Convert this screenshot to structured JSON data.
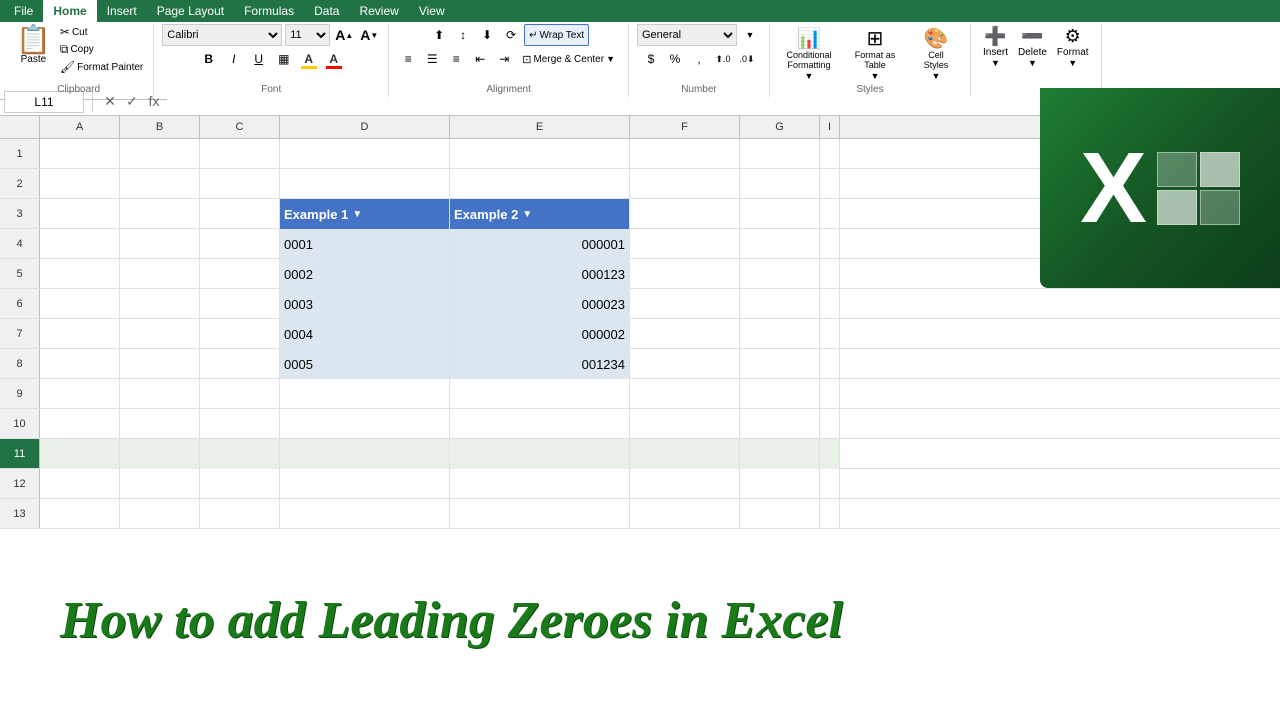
{
  "ribbon": {
    "tabs": [
      "File",
      "Home",
      "Insert",
      "Page Layout",
      "Formulas",
      "Data",
      "Review",
      "View"
    ],
    "active_tab": "Home",
    "clipboard": {
      "label": "Clipboard",
      "paste": "Paste",
      "copy": "Copy",
      "cut": "Cut",
      "format_painter": "Format Painter"
    },
    "font": {
      "label": "Font",
      "name": "Calibri",
      "size": "11",
      "bold": "B",
      "italic": "I",
      "underline": "U",
      "increase_size": "A",
      "decrease_size": "A",
      "fill_color": "A",
      "font_color": "A",
      "borders": "▦"
    },
    "alignment": {
      "label": "Alignment",
      "wrap_text": "Wrap Text",
      "merge_center": "Merge & Center"
    },
    "number": {
      "label": "Number",
      "format": "General",
      "dollar": "$",
      "percent": "%",
      "comma": ",",
      "inc_decimal": ".0",
      "dec_decimal": ".0"
    },
    "styles": {
      "label": "Styles",
      "conditional": "Conditional\nFormatting",
      "format_table": "Format as\nTable",
      "cell_styles": "Cell\nStyles"
    },
    "cells": {
      "label": "",
      "insert": "Insert",
      "delete": "Delete",
      "format": "Format"
    }
  },
  "formula_bar": {
    "name_box": "L11",
    "cancel": "✕",
    "confirm": "✓",
    "function": "fx"
  },
  "columns": [
    "A",
    "B",
    "C",
    "D",
    "E",
    "F",
    "G",
    "I"
  ],
  "rows": [
    {
      "num": 1,
      "cells": [
        "",
        "",
        "",
        "",
        "",
        "",
        "",
        ""
      ]
    },
    {
      "num": 2,
      "cells": [
        "",
        "",
        "",
        "",
        "",
        "",
        "",
        ""
      ]
    },
    {
      "num": 3,
      "cells": [
        "",
        "",
        "",
        "Example 1",
        "Example 2",
        "",
        "",
        ""
      ]
    },
    {
      "num": 4,
      "cells": [
        "",
        "",
        "",
        "0001",
        "000001",
        "",
        "",
        ""
      ]
    },
    {
      "num": 5,
      "cells": [
        "",
        "",
        "",
        "0002",
        "000123",
        "",
        "",
        ""
      ]
    },
    {
      "num": 6,
      "cells": [
        "",
        "",
        "",
        "0003",
        "000023",
        "",
        "",
        ""
      ]
    },
    {
      "num": 7,
      "cells": [
        "",
        "",
        "",
        "0004",
        "000002",
        "",
        "",
        ""
      ]
    },
    {
      "num": 8,
      "cells": [
        "",
        "",
        "",
        "0005",
        "001234",
        "",
        "",
        ""
      ]
    },
    {
      "num": 9,
      "cells": [
        "",
        "",
        "",
        "",
        "",
        "",
        "",
        ""
      ]
    },
    {
      "num": 10,
      "cells": [
        "",
        "",
        "",
        "",
        "",
        "",
        "",
        ""
      ]
    },
    {
      "num": 11,
      "cells": [
        "",
        "",
        "",
        "",
        "",
        "",
        "",
        ""
      ]
    },
    {
      "num": 12,
      "cells": [
        "",
        "",
        "",
        "",
        "",
        "",
        "",
        ""
      ]
    },
    {
      "num": 13,
      "cells": [
        "",
        "",
        "",
        "",
        "",
        "",
        "",
        ""
      ]
    }
  ],
  "bottom_text": "How to add Leading Zeroes in Excel",
  "excel_icon": {
    "x_symbol": "X"
  }
}
